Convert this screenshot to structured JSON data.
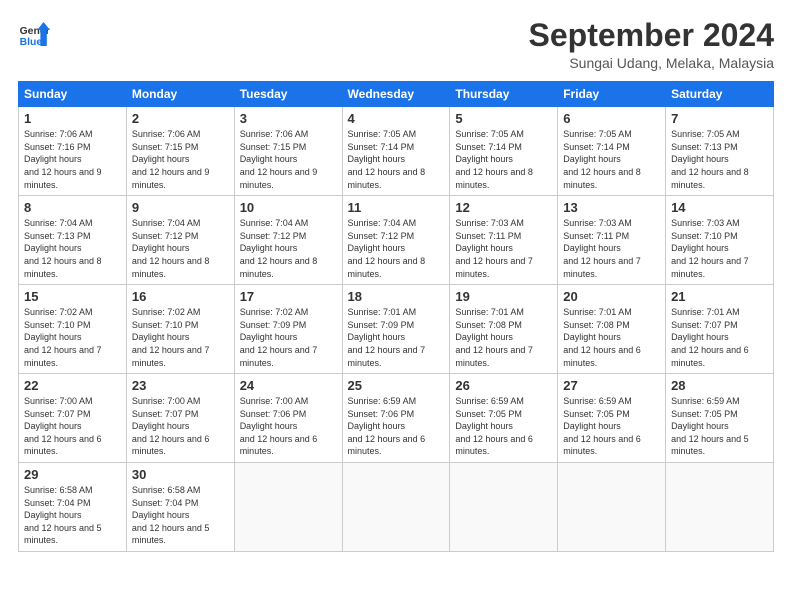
{
  "logo": {
    "line1": "General",
    "line2": "Blue"
  },
  "title": "September 2024",
  "location": "Sungai Udang, Melaka, Malaysia",
  "days_of_week": [
    "Sunday",
    "Monday",
    "Tuesday",
    "Wednesday",
    "Thursday",
    "Friday",
    "Saturday"
  ],
  "weeks": [
    [
      {
        "day": 1,
        "sunrise": "7:06 AM",
        "sunset": "7:16 PM",
        "daylight": "12 hours and 9 minutes."
      },
      {
        "day": 2,
        "sunrise": "7:06 AM",
        "sunset": "7:15 PM",
        "daylight": "12 hours and 9 minutes."
      },
      {
        "day": 3,
        "sunrise": "7:06 AM",
        "sunset": "7:15 PM",
        "daylight": "12 hours and 9 minutes."
      },
      {
        "day": 4,
        "sunrise": "7:05 AM",
        "sunset": "7:14 PM",
        "daylight": "12 hours and 8 minutes."
      },
      {
        "day": 5,
        "sunrise": "7:05 AM",
        "sunset": "7:14 PM",
        "daylight": "12 hours and 8 minutes."
      },
      {
        "day": 6,
        "sunrise": "7:05 AM",
        "sunset": "7:14 PM",
        "daylight": "12 hours and 8 minutes."
      },
      {
        "day": 7,
        "sunrise": "7:05 AM",
        "sunset": "7:13 PM",
        "daylight": "12 hours and 8 minutes."
      }
    ],
    [
      {
        "day": 8,
        "sunrise": "7:04 AM",
        "sunset": "7:13 PM",
        "daylight": "12 hours and 8 minutes."
      },
      {
        "day": 9,
        "sunrise": "7:04 AM",
        "sunset": "7:12 PM",
        "daylight": "12 hours and 8 minutes."
      },
      {
        "day": 10,
        "sunrise": "7:04 AM",
        "sunset": "7:12 PM",
        "daylight": "12 hours and 8 minutes."
      },
      {
        "day": 11,
        "sunrise": "7:04 AM",
        "sunset": "7:12 PM",
        "daylight": "12 hours and 8 minutes."
      },
      {
        "day": 12,
        "sunrise": "7:03 AM",
        "sunset": "7:11 PM",
        "daylight": "12 hours and 7 minutes."
      },
      {
        "day": 13,
        "sunrise": "7:03 AM",
        "sunset": "7:11 PM",
        "daylight": "12 hours and 7 minutes."
      },
      {
        "day": 14,
        "sunrise": "7:03 AM",
        "sunset": "7:10 PM",
        "daylight": "12 hours and 7 minutes."
      }
    ],
    [
      {
        "day": 15,
        "sunrise": "7:02 AM",
        "sunset": "7:10 PM",
        "daylight": "12 hours and 7 minutes."
      },
      {
        "day": 16,
        "sunrise": "7:02 AM",
        "sunset": "7:10 PM",
        "daylight": "12 hours and 7 minutes."
      },
      {
        "day": 17,
        "sunrise": "7:02 AM",
        "sunset": "7:09 PM",
        "daylight": "12 hours and 7 minutes."
      },
      {
        "day": 18,
        "sunrise": "7:01 AM",
        "sunset": "7:09 PM",
        "daylight": "12 hours and 7 minutes."
      },
      {
        "day": 19,
        "sunrise": "7:01 AM",
        "sunset": "7:08 PM",
        "daylight": "12 hours and 7 minutes."
      },
      {
        "day": 20,
        "sunrise": "7:01 AM",
        "sunset": "7:08 PM",
        "daylight": "12 hours and 6 minutes."
      },
      {
        "day": 21,
        "sunrise": "7:01 AM",
        "sunset": "7:07 PM",
        "daylight": "12 hours and 6 minutes."
      }
    ],
    [
      {
        "day": 22,
        "sunrise": "7:00 AM",
        "sunset": "7:07 PM",
        "daylight": "12 hours and 6 minutes."
      },
      {
        "day": 23,
        "sunrise": "7:00 AM",
        "sunset": "7:07 PM",
        "daylight": "12 hours and 6 minutes."
      },
      {
        "day": 24,
        "sunrise": "7:00 AM",
        "sunset": "7:06 PM",
        "daylight": "12 hours and 6 minutes."
      },
      {
        "day": 25,
        "sunrise": "6:59 AM",
        "sunset": "7:06 PM",
        "daylight": "12 hours and 6 minutes."
      },
      {
        "day": 26,
        "sunrise": "6:59 AM",
        "sunset": "7:05 PM",
        "daylight": "12 hours and 6 minutes."
      },
      {
        "day": 27,
        "sunrise": "6:59 AM",
        "sunset": "7:05 PM",
        "daylight": "12 hours and 6 minutes."
      },
      {
        "day": 28,
        "sunrise": "6:59 AM",
        "sunset": "7:05 PM",
        "daylight": "12 hours and 5 minutes."
      }
    ],
    [
      {
        "day": 29,
        "sunrise": "6:58 AM",
        "sunset": "7:04 PM",
        "daylight": "12 hours and 5 minutes."
      },
      {
        "day": 30,
        "sunrise": "6:58 AM",
        "sunset": "7:04 PM",
        "daylight": "12 hours and 5 minutes."
      },
      null,
      null,
      null,
      null,
      null
    ]
  ]
}
